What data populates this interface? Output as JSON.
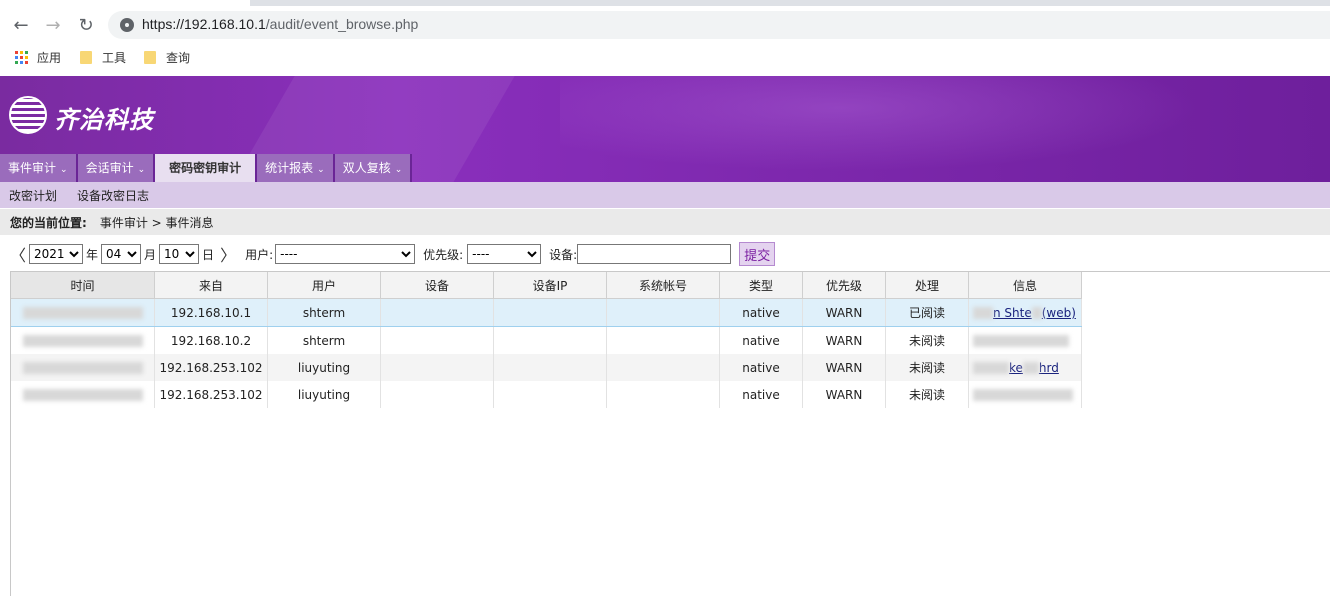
{
  "browser": {
    "url_host": "https://192.168.10.1",
    "url_path": "/audit/event_browse.php",
    "bookmarks": [
      {
        "label": "应用",
        "icon": "apps-grid-icon"
      },
      {
        "label": "工具",
        "icon": "folder-icon"
      },
      {
        "label": "查询",
        "icon": "folder-icon"
      }
    ]
  },
  "brand": {
    "name": "齐治科技"
  },
  "menu": {
    "tabs": [
      {
        "label": "事件审计",
        "active": false
      },
      {
        "label": "会话审计",
        "active": false
      },
      {
        "label": "密码密钥审计",
        "active": true
      },
      {
        "label": "统计报表",
        "active": false
      },
      {
        "label": "双人复核",
        "active": false
      }
    ],
    "submenu": [
      "改密计划",
      "设备改密日志"
    ]
  },
  "breadcrumb": {
    "label": "您的当前位置:",
    "path": "事件审计 > 事件消息"
  },
  "filter": {
    "year": "2021",
    "year_unit": "年",
    "month": "04",
    "month_unit": "月",
    "day": "10",
    "day_unit": "日",
    "user_label": "用户:",
    "user_value": "----",
    "priority_label": "优先级:",
    "priority_value": "----",
    "device_label": "设备:",
    "device_value": "",
    "submit_label": "提交"
  },
  "table": {
    "columns": [
      "时间",
      "来自",
      "用户",
      "设备",
      "设备IP",
      "系统帐号",
      "类型",
      "优先级",
      "处理",
      "信息"
    ],
    "rows": [
      {
        "from": "192.168.10.1",
        "user": "shterm",
        "device": "",
        "device_ip": "",
        "account": "",
        "type": "native",
        "priority": "WARN",
        "status": "已阅读",
        "info": "n Shte",
        "info2": "(web)"
      },
      {
        "from": "192.168.10.2",
        "user": "shterm",
        "device": "",
        "device_ip": "",
        "account": "",
        "type": "native",
        "priority": "WARN",
        "status": "未阅读",
        "info": "",
        "info2": ""
      },
      {
        "from": "192.168.253.102",
        "user": "liuyuting",
        "device": "",
        "device_ip": "",
        "account": "",
        "type": "native",
        "priority": "WARN",
        "status": "未阅读",
        "info": "ke",
        "info2": "hrd"
      },
      {
        "from": "192.168.253.102",
        "user": "liuyuting",
        "device": "",
        "device_ip": "",
        "account": "",
        "type": "native",
        "priority": "WARN",
        "status": "未阅读",
        "info": "",
        "info2": ""
      }
    ]
  },
  "colors": {
    "banner": "#7d28ad",
    "tab": "#9a6cbc",
    "submenu": "#d9c9e8",
    "selected_row": "#dff0fa"
  }
}
